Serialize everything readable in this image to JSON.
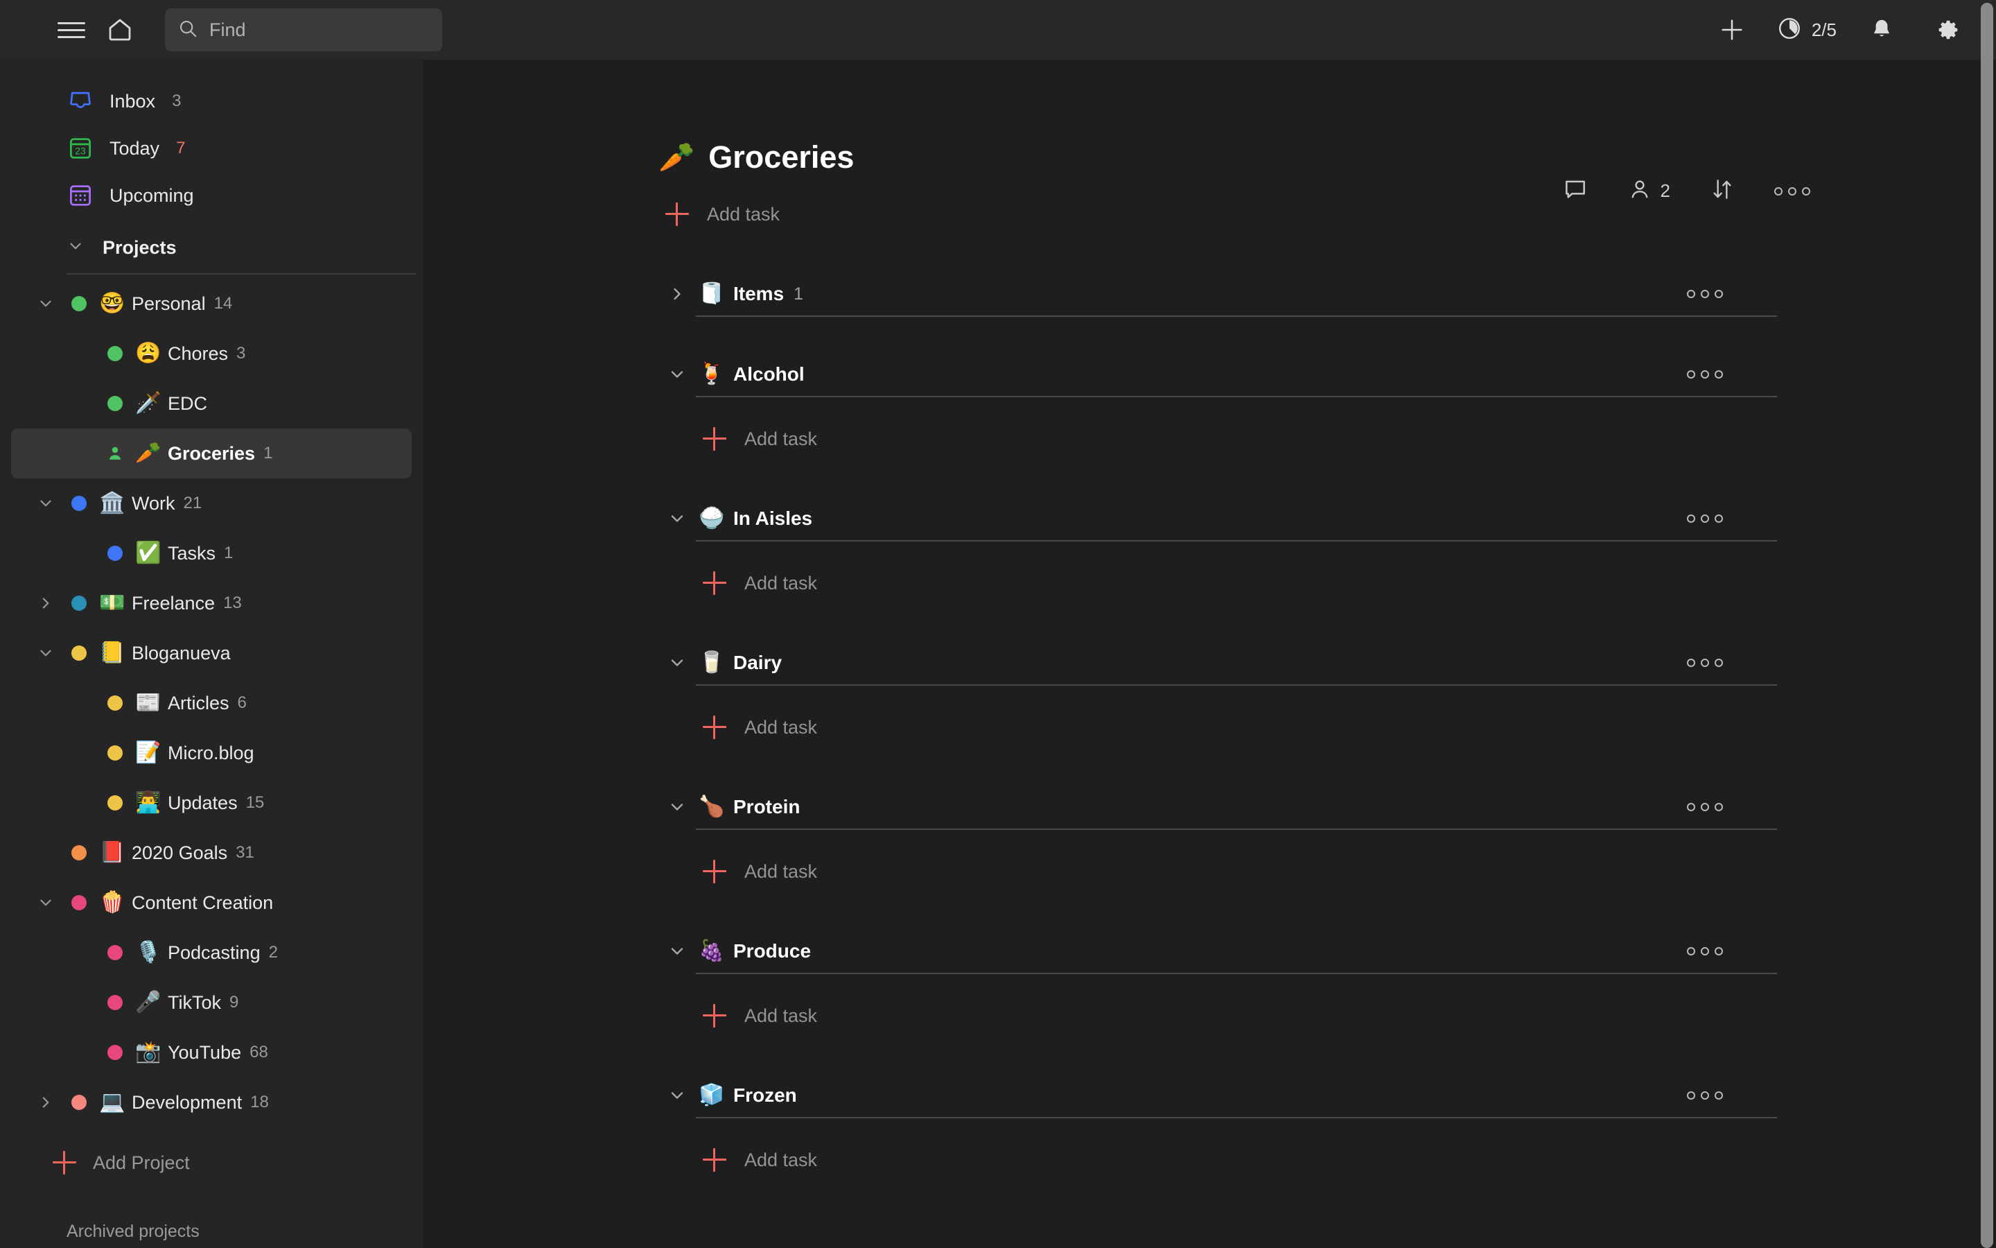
{
  "topbar": {
    "menu_icon": "hamburger-menu-icon",
    "home_icon": "home-icon",
    "search": {
      "icon": "search-icon",
      "placeholder": "Find",
      "value": ""
    },
    "add_icon": "plus-icon",
    "karma": {
      "icon": "productivity-pie-icon",
      "value": "2/5"
    },
    "notifications_icon": "bell-icon",
    "settings_icon": "gear-icon"
  },
  "sidebar": {
    "nav": [
      {
        "label": "Inbox",
        "count": "3",
        "icon": "inbox-icon",
        "color": "#4073ff",
        "count_color": "gray"
      },
      {
        "label": "Today",
        "count": "7",
        "icon": "calendar-today-icon",
        "color": "#2fbd4f",
        "count_color": "red",
        "day": "23"
      },
      {
        "label": "Upcoming",
        "count": "",
        "icon": "calendar-upcoming-icon",
        "color": "#a970ff"
      }
    ],
    "projects_header": {
      "label": "Projects",
      "expanded": true
    },
    "projects": [
      {
        "name": "Personal",
        "count": "14",
        "emoji": "🤓",
        "dot": "#4fc463",
        "indent": 0,
        "toggle": "expanded",
        "shared": false
      },
      {
        "name": "Chores",
        "count": "3",
        "emoji": "😩",
        "dot": "#4fc463",
        "indent": 1,
        "toggle": "none",
        "shared": false
      },
      {
        "name": "EDC",
        "count": "",
        "emoji": "🗡️",
        "dot": "#4fc463",
        "indent": 1,
        "toggle": "none",
        "shared": false
      },
      {
        "name": "Groceries",
        "count": "1",
        "emoji": "🥕",
        "dot": "#4fc463",
        "indent": 1,
        "toggle": "none",
        "shared": true,
        "selected": true
      },
      {
        "name": "Work",
        "count": "21",
        "emoji": "🏛️",
        "dot": "#3f76f6",
        "indent": 0,
        "toggle": "expanded",
        "shared": false
      },
      {
        "name": "Tasks",
        "count": "1",
        "emoji": "✅",
        "dot": "#3f76f6",
        "indent": 1,
        "toggle": "none",
        "shared": false
      },
      {
        "name": "Freelance",
        "count": "13",
        "emoji": "💵",
        "dot": "#2b90b6",
        "indent": 0,
        "toggle": "collapsed",
        "shared": false
      },
      {
        "name": "Bloganueva",
        "count": "",
        "emoji": "📒",
        "dot": "#eec447",
        "indent": 0,
        "toggle": "expanded",
        "shared": false
      },
      {
        "name": "Articles",
        "count": "6",
        "emoji": "📰",
        "dot": "#eec447",
        "indent": 1,
        "toggle": "none",
        "shared": false
      },
      {
        "name": "Micro.blog",
        "count": "",
        "emoji": "📝",
        "dot": "#eec447",
        "indent": 1,
        "toggle": "none",
        "shared": false
      },
      {
        "name": "Updates",
        "count": "15",
        "emoji": "👨‍💻",
        "dot": "#eec447",
        "indent": 1,
        "toggle": "none",
        "shared": false
      },
      {
        "name": "2020 Goals",
        "count": "31",
        "emoji": "📕",
        "dot": "#f3914b",
        "indent": 0,
        "toggle": "none",
        "shared": false
      },
      {
        "name": "Content Creation",
        "count": "",
        "emoji": "🍿",
        "dot": "#e8467f",
        "indent": 0,
        "toggle": "expanded",
        "shared": false
      },
      {
        "name": "Podcasting",
        "count": "2",
        "emoji": "🎙️",
        "dot": "#e8467f",
        "indent": 1,
        "toggle": "none",
        "shared": false
      },
      {
        "name": "TikTok",
        "count": "9",
        "emoji": "🎤",
        "dot": "#e8467f",
        "indent": 1,
        "toggle": "none",
        "shared": false
      },
      {
        "name": "YouTube",
        "count": "68",
        "emoji": "📸",
        "dot": "#e8467f",
        "indent": 1,
        "toggle": "none",
        "shared": false
      },
      {
        "name": "Development",
        "count": "18",
        "emoji": "💻",
        "dot": "#f4887e",
        "indent": 0,
        "toggle": "collapsed",
        "shared": false
      }
    ],
    "add_project": {
      "label": "Add Project",
      "icon": "plus-icon"
    },
    "archived": "Archived projects"
  },
  "main": {
    "title": "Groceries",
    "title_emoji": "🥕",
    "actions": {
      "comments_icon": "comment-bubble-icon",
      "collaborators_icon": "person-icon",
      "collaborators_count": "2",
      "sort_icon": "sort-arrows-icon",
      "more_icon": "more-options-icon"
    },
    "add_task_label": "Add task",
    "sections": [
      {
        "name": "Items",
        "count": "1",
        "emoji": "🧻",
        "expanded": false
      },
      {
        "name": "Alcohol",
        "count": "",
        "emoji": "🍹",
        "expanded": true
      },
      {
        "name": "In Aisles",
        "count": "",
        "emoji": "🍚",
        "expanded": true
      },
      {
        "name": "Dairy",
        "count": "",
        "emoji": "🥛",
        "expanded": true
      },
      {
        "name": "Protein",
        "count": "",
        "emoji": "🍗",
        "expanded": true
      },
      {
        "name": "Produce",
        "count": "",
        "emoji": "🍇",
        "expanded": true
      },
      {
        "name": "Frozen",
        "count": "",
        "emoji": "🧊",
        "expanded": true
      }
    ]
  },
  "colors": {
    "accent": "#f0655e",
    "sidebar_bg": "#252525",
    "main_bg": "#1e1e1e",
    "topbar_bg": "#282828"
  }
}
